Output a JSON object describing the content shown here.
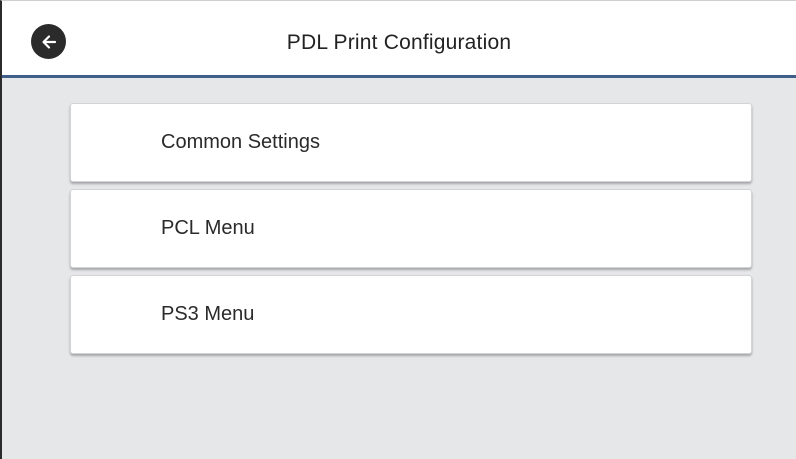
{
  "header": {
    "title": "PDL Print Configuration",
    "back_icon": "back-arrow-icon"
  },
  "menu": {
    "items": [
      {
        "label": "Common Settings"
      },
      {
        "label": "PCL Menu"
      },
      {
        "label": "PS3 Menu"
      }
    ]
  },
  "colors": {
    "background": "#e6e7e9",
    "header_background": "#ffffff",
    "header_underline": "#3f5f8a",
    "back_button": "#2b2b2b",
    "menu_item_background": "#ffffff",
    "text": "#222222"
  }
}
